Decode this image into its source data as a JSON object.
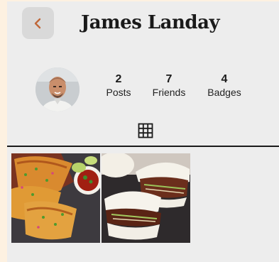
{
  "profile": {
    "name": "James Landay",
    "avatar_icon": "person-photo"
  },
  "stats": [
    {
      "value": "2",
      "label": "Posts"
    },
    {
      "value": "7",
      "label": "Friends"
    },
    {
      "value": "4",
      "label": "Badges"
    }
  ],
  "nav": {
    "back_icon": "chevron-left-icon",
    "grid_icon": "grid-icon"
  },
  "posts": [
    {
      "name": "tacos-photo"
    },
    {
      "name": "bao-buns-photo"
    }
  ],
  "colors": {
    "accent": "#c0683a",
    "page_bg": "#ededed",
    "outer_bg": "#fdf1e1"
  }
}
